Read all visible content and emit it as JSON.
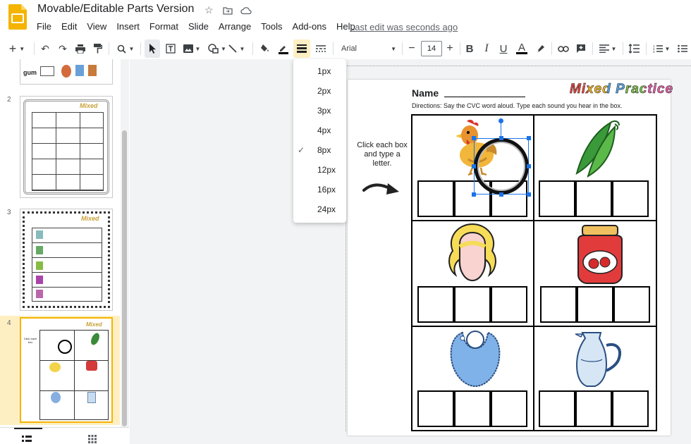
{
  "header": {
    "doc_title": "Movable/Editable Parts Version",
    "last_edit": "Last edit was seconds ago",
    "menu": [
      "File",
      "Edit",
      "View",
      "Insert",
      "Format",
      "Slide",
      "Arrange",
      "Tools",
      "Add-ons",
      "Help"
    ]
  },
  "toolbar": {
    "font_name": "Arial",
    "font_size": "14"
  },
  "filmstrip": {
    "slides": [
      {
        "number": "2"
      },
      {
        "number": "3"
      },
      {
        "number": "4"
      }
    ],
    "partial_word": "gum"
  },
  "dropdown": {
    "options": [
      "1px",
      "2px",
      "3px",
      "4px",
      "8px",
      "12px",
      "16px",
      "24px"
    ],
    "selected": "8px"
  },
  "slide": {
    "name_label": "Name",
    "title_art": "Mixed Practice",
    "directions": "Directions: Say the CVC word aloud. Type each sound you hear in the box.",
    "hint": "Click each box and type a letter."
  },
  "colors": {
    "accent": "#1a73e8",
    "selected_thumb": "#feefc3",
    "logo": "#f4b400"
  }
}
